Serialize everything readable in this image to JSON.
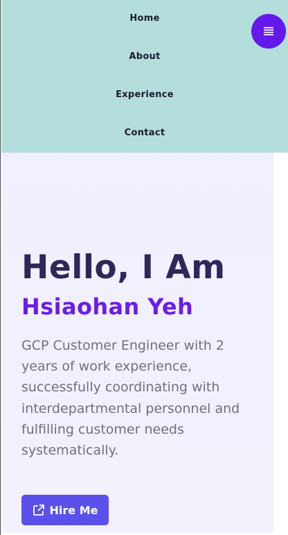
{
  "nav": {
    "items": [
      {
        "label": "Home"
      },
      {
        "label": "About"
      },
      {
        "label": "Experience"
      },
      {
        "label": "Contact"
      }
    ],
    "toggle_icon": "menu-lines-icon"
  },
  "hero": {
    "greeting": "Hello, I Am",
    "name": "Hsiaohan Yeh",
    "bio": "GCP Customer Engineer with 2 years of work experience, successfully coordinating with interdepartmental personnel and fulfilling customer needs systematically.",
    "cta": {
      "label": "Hire Me",
      "icon": "external-link-icon"
    }
  },
  "colors": {
    "nav_bg": "#b4dedb",
    "accent": "#6419ea",
    "heading": "#2f2759",
    "name": "#6a1ee8",
    "button": "#5b50ea",
    "body_text": "#70707a"
  }
}
